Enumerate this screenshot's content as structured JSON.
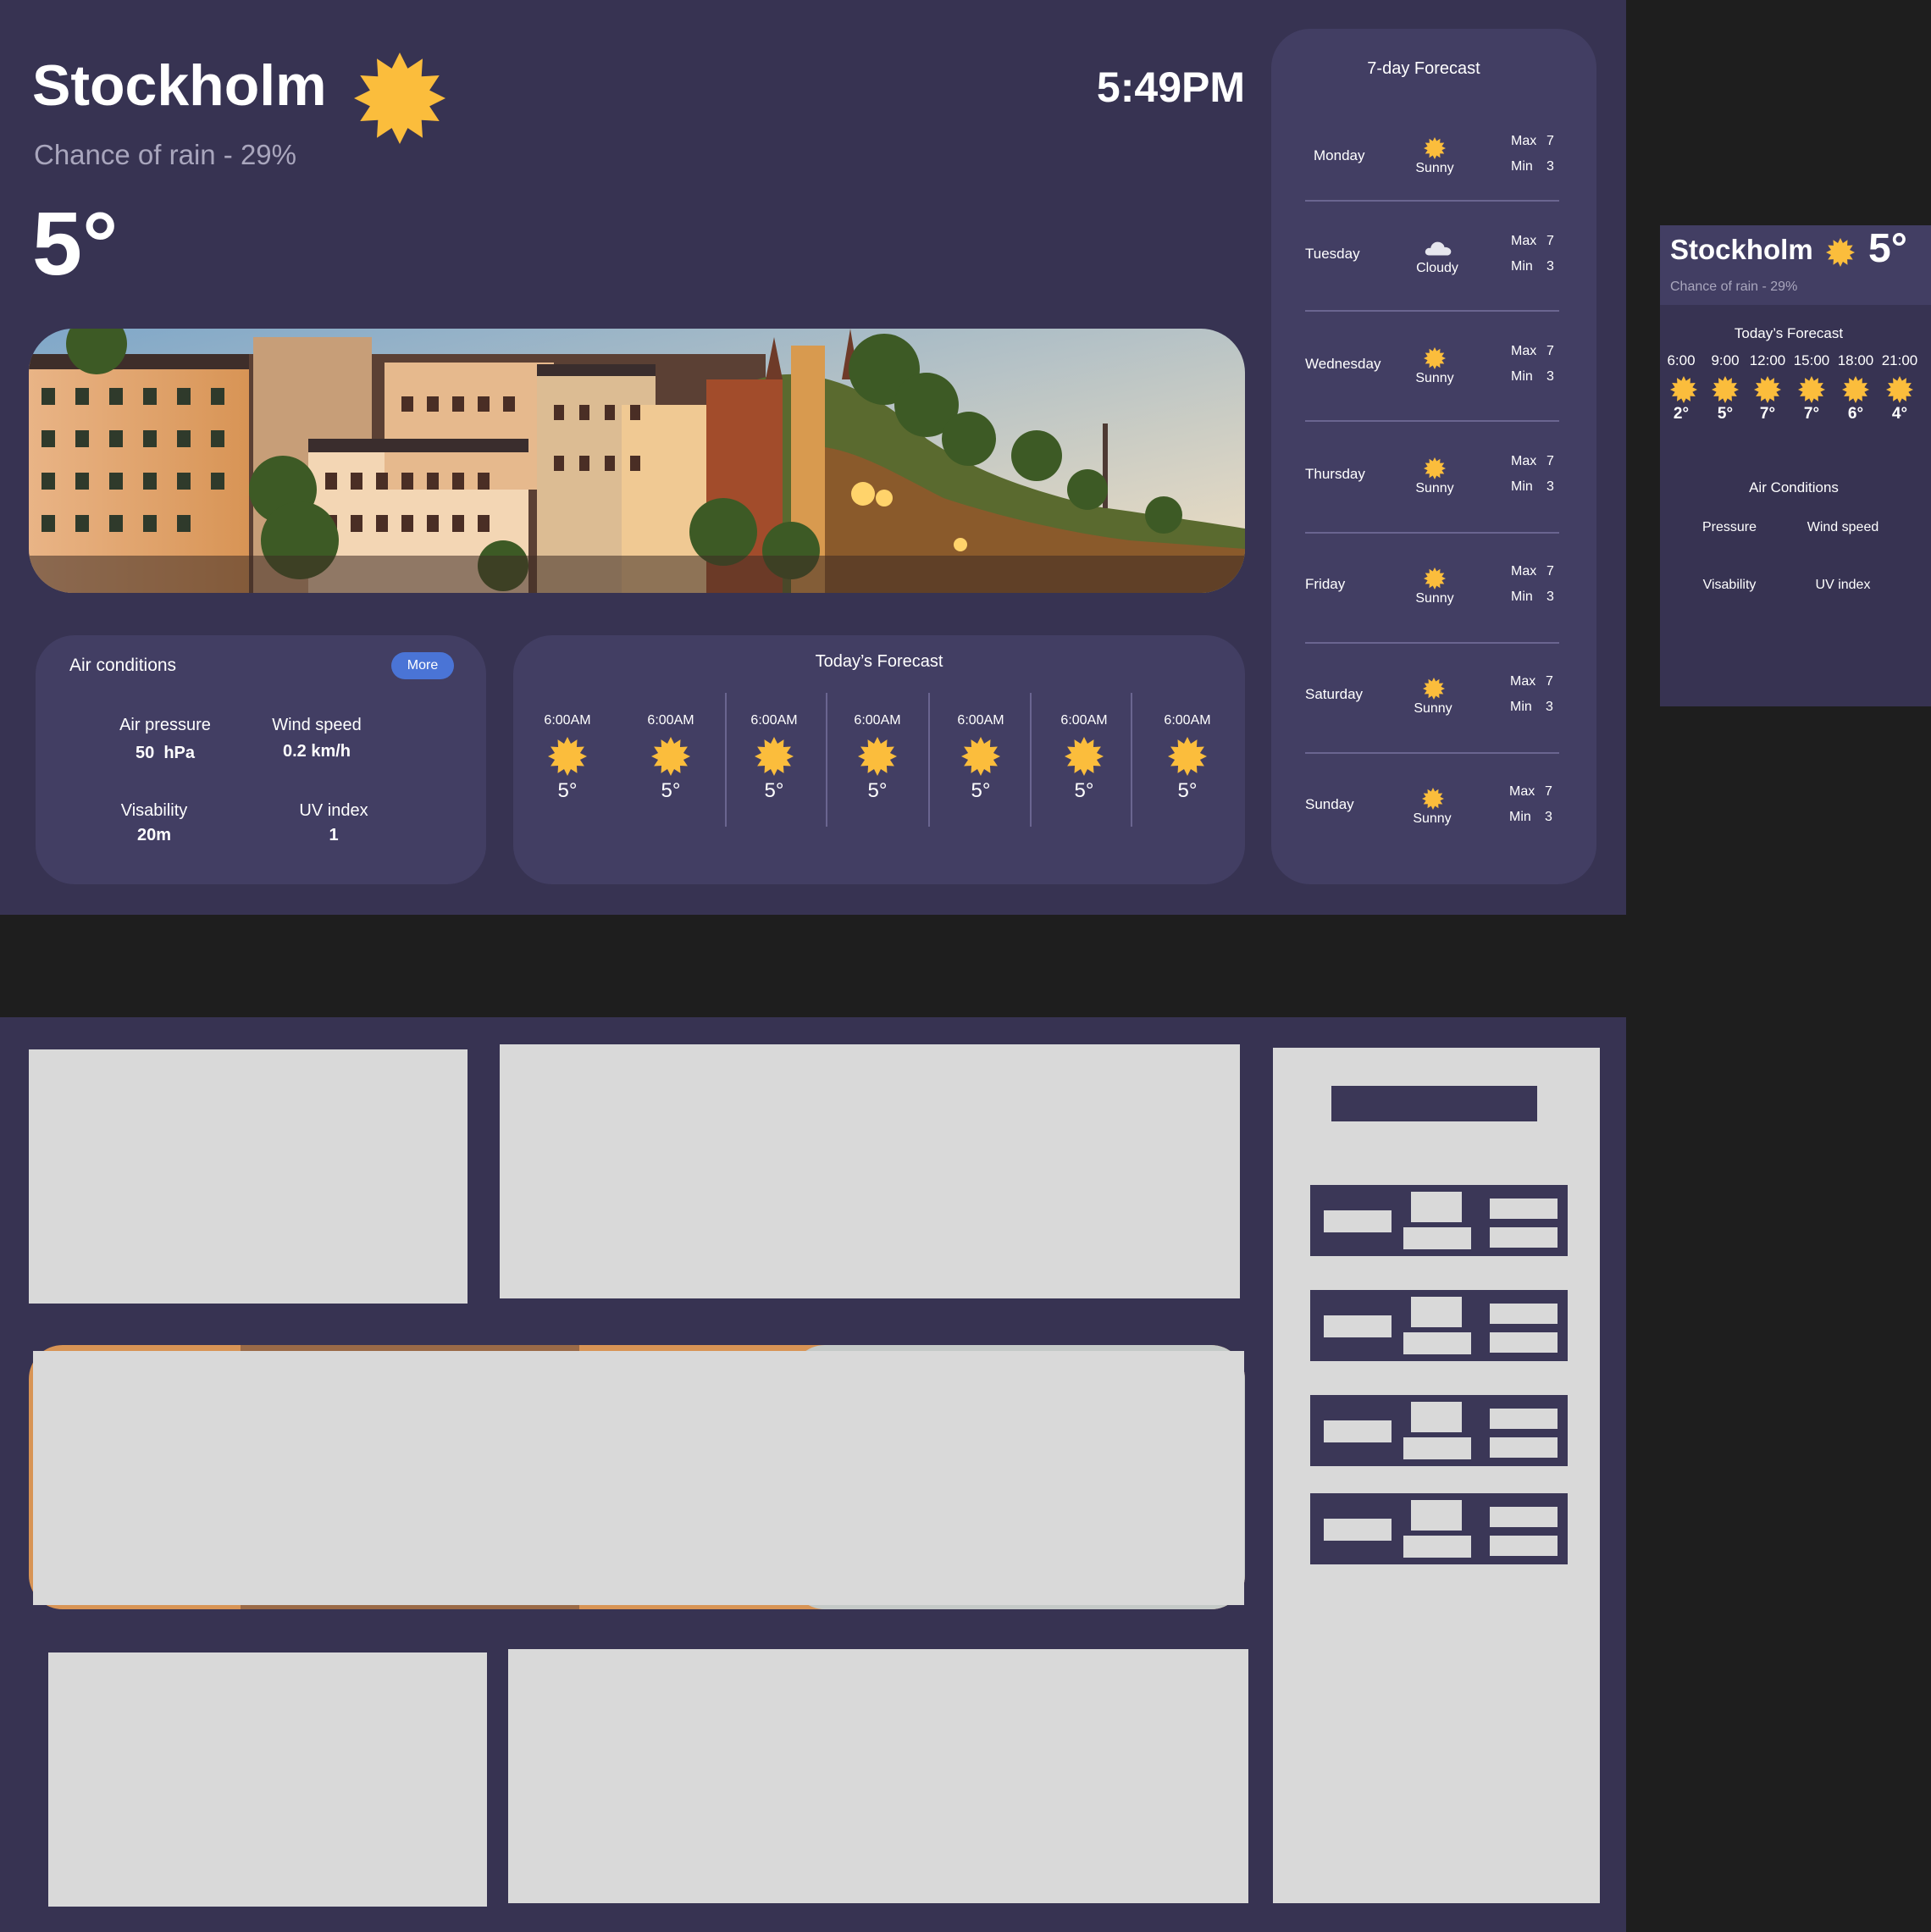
{
  "main": {
    "city": "Stockholm",
    "rain": "Chance of rain - 29%",
    "temp": "5°",
    "time": "5:49PM",
    "weather_icon": "sun-icon"
  },
  "air": {
    "title": "Air conditions",
    "more": "More",
    "pressure_label": "Air pressure",
    "pressure_value": "50  hPa",
    "wind_label": "Wind speed",
    "wind_value": "0.2 km/h",
    "vis_label": "Visability",
    "vis_value": "20m",
    "uv_label": "UV index",
    "uv_value": "1"
  },
  "today": {
    "title": "Today’s Forecast",
    "items": [
      {
        "time": "6:00AM",
        "temp": "5°"
      },
      {
        "time": "6:00AM",
        "temp": "5°"
      },
      {
        "time": "6:00AM",
        "temp": "5°"
      },
      {
        "time": "6:00AM",
        "temp": "5°"
      },
      {
        "time": "6:00AM",
        "temp": "5°"
      },
      {
        "time": "6:00AM",
        "temp": "5°"
      },
      {
        "time": "6:00AM",
        "temp": "5°"
      }
    ]
  },
  "week": {
    "title": "7-day Forecast",
    "max_label": "Max",
    "min_label": "Min",
    "days": [
      {
        "day": "Monday",
        "cond": "Sunny",
        "icon": "sun-icon",
        "max": "7",
        "min": "3"
      },
      {
        "day": "Tuesday",
        "cond": "Cloudy",
        "icon": "cloud-icon",
        "max": "7",
        "min": "3"
      },
      {
        "day": "Wednesday",
        "cond": "Sunny",
        "icon": "sun-icon",
        "max": "7",
        "min": "3"
      },
      {
        "day": "Thursday",
        "cond": "Sunny",
        "icon": "sun-icon",
        "max": "7",
        "min": "3"
      },
      {
        "day": "Friday",
        "cond": "Sunny",
        "icon": "sun-icon",
        "max": "7",
        "min": "3"
      },
      {
        "day": "Saturday",
        "cond": "Sunny",
        "icon": "sun-icon",
        "max": "7",
        "min": "3"
      },
      {
        "day": "Sunday",
        "cond": "Sunny",
        "icon": "sun-icon",
        "max": "7",
        "min": "3"
      }
    ]
  },
  "mobile": {
    "city": "Stockholm",
    "temp": "5°",
    "rain": "Chance of rain - 29%",
    "today_title": "Today’s Forecast",
    "hours": [
      {
        "time": "6:00",
        "temp": "2°"
      },
      {
        "time": "9:00",
        "temp": "5°"
      },
      {
        "time": "12:00",
        "temp": "7°"
      },
      {
        "time": "15:00",
        "temp": "7°"
      },
      {
        "time": "18:00",
        "temp": "6°"
      },
      {
        "time": "21:00",
        "temp": "4°"
      }
    ],
    "air_title": "Air Conditions",
    "pressure": "Pressure",
    "wind": "Wind speed",
    "vis": "Visability",
    "uv": "UV index"
  },
  "colors": {
    "frame": "#373352",
    "card": "#423e63",
    "sun": "#fbbd3c",
    "more_button": "#4a74d6",
    "wireframe": "#d9d9d9"
  }
}
